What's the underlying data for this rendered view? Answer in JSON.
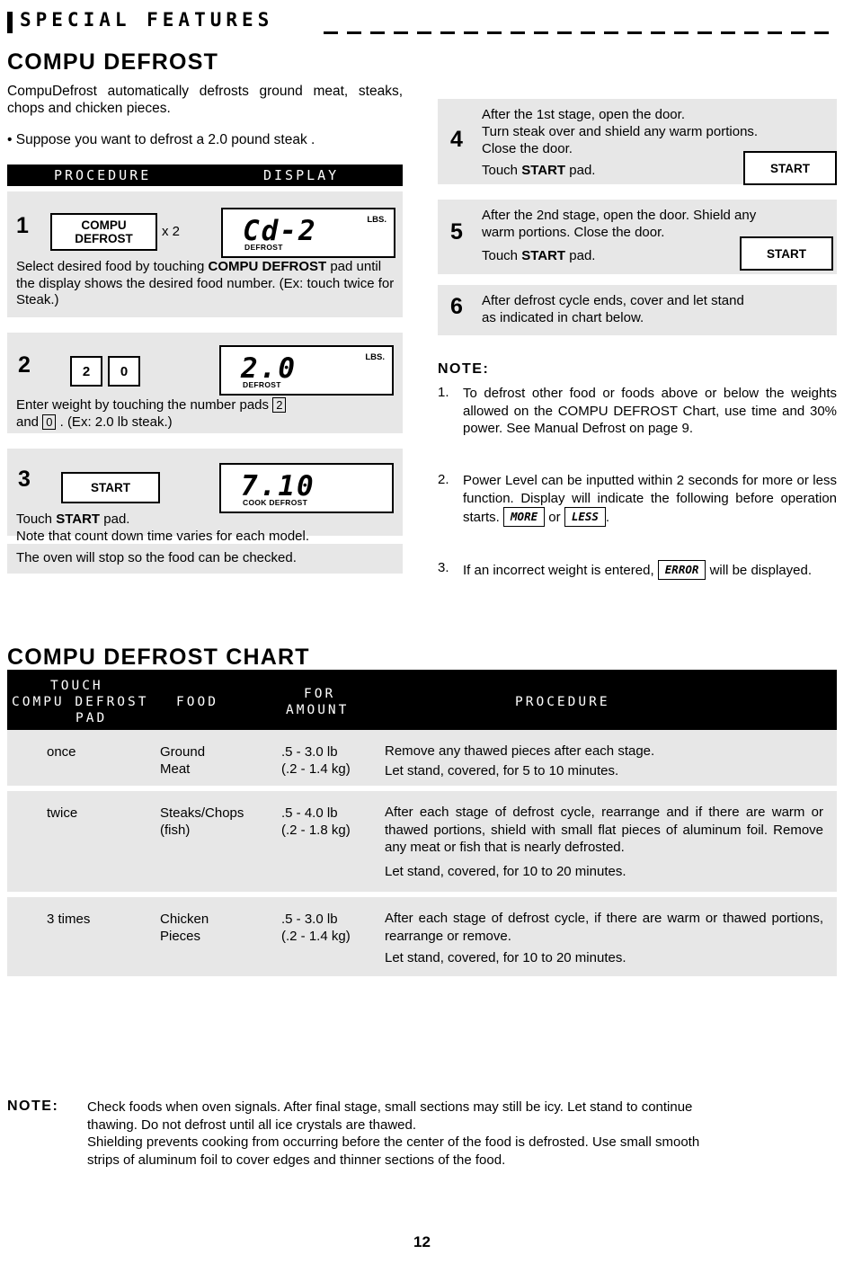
{
  "header": {
    "title": "SPECIAL FEATURES"
  },
  "sections": {
    "compu_defrost_title": "COMPU DEFROST",
    "compu_defrost_chart_title": "COMPU DEFROST CHART"
  },
  "intro": {
    "paragraph": "CompuDefrost automatically defrosts ground meat, steaks, chops and chicken pieces.",
    "bullet": "•  Suppose you want to defrost a 2.0 pound steak ."
  },
  "procedure_table": {
    "col_procedure": "PROCEDURE",
    "col_display": "DISPLAY",
    "steps": [
      {
        "num": "1",
        "pad_line1": "COMPU",
        "pad_line2": "DEFROST",
        "pad_suffix": "x 2",
        "display_main": "Cd-2",
        "display_lbs": "LBS.",
        "display_sub": "DEFROST",
        "text": "Select desired food by touching COMPU DEFROST pad until the display shows the desired food number. (Ex: touch twice for Steak.)",
        "text_bold": "COMPU DEFROST"
      },
      {
        "num": "2",
        "key1": "2",
        "key2": "0",
        "display_main": "2.0",
        "display_lbs": "LBS.",
        "display_sub": "DEFROST",
        "text": "Enter weight by touching the number pads  2  and  0 . (Ex: 2.0 lb steak.)"
      },
      {
        "num": "3",
        "pad_line1": "START",
        "display_main": "7.10",
        "display_sub": "COOK DEFROST",
        "text_line1": "Touch START pad.",
        "text_line2": "Note that count down time varies for each model."
      }
    ],
    "footer_note": "The oven will stop so the food can be checked."
  },
  "right_steps": [
    {
      "num": "4",
      "line1": "After the 1st stage, open the door.",
      "line2": "Turn steak over and shield any warm portions.",
      "line3": "Close the door.",
      "line4": "Touch START pad.",
      "pad": "START"
    },
    {
      "num": "5",
      "line1": "After the 2nd stage, open the door. Shield any",
      "line2": "warm portions. Close the door.",
      "line3": "Touch START pad.",
      "pad": "START"
    },
    {
      "num": "6",
      "line1": "After defrost cycle ends, cover and let stand",
      "line2": "as indicated in chart below."
    }
  ],
  "note": {
    "heading": "NOTE:",
    "items": [
      {
        "num": "1.",
        "text": "To defrost other food or foods above or below the weights allowed on the COMPU DEFROST Chart, use time and 30% power. See Manual Defrost on page 9."
      },
      {
        "num": "2.",
        "text_a": "Power Level can be inputted within 2 seconds for more or less function. Display will indicate the following before operation starts.",
        "disp_more": "MORE",
        "or_text": "or",
        "disp_less": "LESS",
        "text_b": "."
      },
      {
        "num": "3.",
        "text_a": "If an incorrect weight is entered,",
        "disp_error": "ERROR",
        "text_b": "will be displayed."
      }
    ]
  },
  "chart": {
    "headers": {
      "touch_line1": "TOUCH",
      "touch_line2": "COMPU DEFROST",
      "touch_line3": "PAD",
      "food": "FOOD",
      "amount_line1": "FOR",
      "amount_line2": "AMOUNT",
      "procedure": "PROCEDURE"
    },
    "rows": [
      {
        "touch": "once",
        "food_line1": "Ground",
        "food_line2": "Meat",
        "amount_line1": ".5 - 3.0 lb",
        "amount_line2": "(.2 - 1.4 kg)",
        "proc_line1": "Remove any thawed pieces after each stage.",
        "proc_line2": "Let stand, covered, for  5 to 10 minutes."
      },
      {
        "touch": "twice",
        "food_line1": "Steaks/Chops",
        "food_line2": "(fish)",
        "amount_line1": ".5 - 4.0 lb",
        "amount_line2": "(.2 - 1.8 kg)",
        "proc_line1": "After each stage of defrost cycle, rearrange and if there are warm or thawed portions, shield with small flat pieces of aluminum foil. Remove any meat or fish that is nearly defrosted.",
        "proc_line2": "Let stand, covered, for 10 to 20 minutes."
      },
      {
        "touch": "3 times",
        "food_line1": "Chicken",
        "food_line2": "Pieces",
        "amount_line1": ".5 - 3.0 lb",
        "amount_line2": "(.2 - 1.4 kg)",
        "proc_line1": "After each stage of defrost cycle, if there are warm or thawed portions, rearrange or remove.",
        "proc_line2": "Let stand, covered, for 10 to 20 minutes."
      }
    ]
  },
  "bottom_note": {
    "heading": "NOTE:",
    "line1": "Check foods when oven signals. After final stage, small sections may still be icy. Let stand to continue",
    "line2": "thawing. Do not defrost until all ice crystals are thawed.",
    "line3": "Shielding prevents cooking from occurring before the center of the food is defrosted. Use small smooth",
    "line4": "strips of aluminum foil to cover edges and thinner sections of the food."
  },
  "page_number": "12"
}
